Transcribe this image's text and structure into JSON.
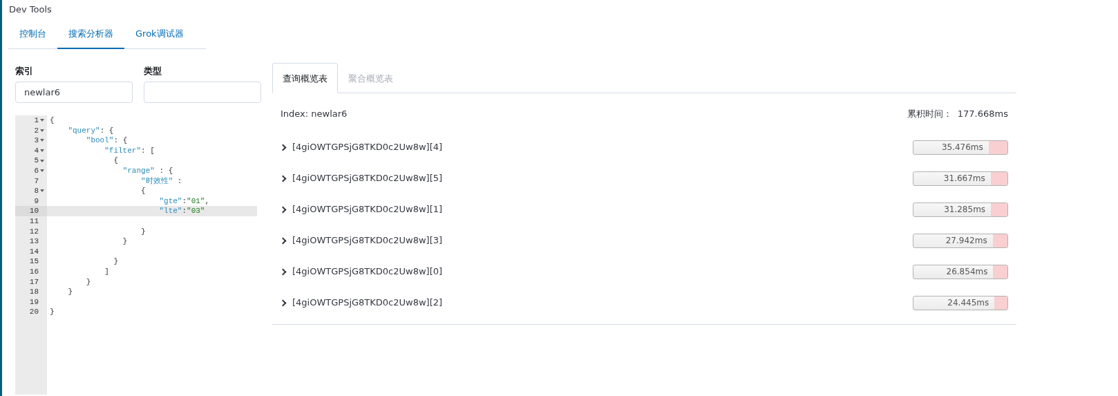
{
  "window": {
    "title": "Dev Tools"
  },
  "tabs": [
    {
      "label": "控制台",
      "selected": false
    },
    {
      "label": "搜索分析器",
      "selected": true
    },
    {
      "label": "Grok调试器",
      "selected": false
    }
  ],
  "fields": [
    {
      "label": "索引",
      "value": "newlar6"
    },
    {
      "label": "类型"
    }
  ],
  "editor": {
    "lines": [
      {
        "number": "1",
        "text": "{",
        "foldable": true,
        "active": false
      },
      {
        "number": "2",
        "text": "    \"query\": {",
        "foldable": true,
        "active": false
      },
      {
        "number": "3",
        "text": "        \"bool\": {",
        "foldable": true,
        "active": false
      },
      {
        "number": "4",
        "text": "            \"filter\": [",
        "foldable": true,
        "active": false
      },
      {
        "number": "5",
        "text": "              {",
        "foldable": true,
        "active": false
      },
      {
        "number": "6",
        "text": "                \"range\" : {",
        "foldable": true,
        "active": false
      },
      {
        "number": "7",
        "text": "                    \"时效性\" :",
        "foldable": false,
        "active": false
      },
      {
        "number": "8",
        "text": "                    {",
        "foldable": true,
        "active": false
      },
      {
        "number": "9",
        "text": "                        \"gte\":\"01\",",
        "foldable": false,
        "active": false
      },
      {
        "number": "10",
        "text": "                        \"lte\":\"03\"",
        "foldable": false,
        "active": true
      },
      {
        "number": "11",
        "foldable": false,
        "active": false
      },
      {
        "number": "12",
        "text": "                    }",
        "foldable": false,
        "active": false
      },
      {
        "number": "13",
        "text": "                }",
        "foldable": false,
        "active": false
      },
      {
        "number": "14",
        "foldable": false,
        "active": false
      },
      {
        "number": "15",
        "text": "              }",
        "foldable": false,
        "active": false
      },
      {
        "number": "16",
        "text": "            ]",
        "foldable": false,
        "active": false
      },
      {
        "number": "17",
        "text": "        }",
        "foldable": false,
        "active": false
      },
      {
        "number": "18",
        "text": "    }",
        "foldable": false,
        "active": false
      },
      {
        "number": "19",
        "foldable": false,
        "active": false
      },
      {
        "number": "20",
        "text": "}",
        "foldable": false,
        "active": false
      }
    ]
  },
  "profile": {
    "tabs": [
      {
        "label": "查询概览表",
        "selected": true
      },
      {
        "label": "聚合概览表",
        "selected": false
      }
    ],
    "index": "Index: newlar6",
    "total_label": "累积时间：",
    "total": "177.668ms",
    "shards": [
      {
        "name": "[4giOWTGPSjG8TKD0c2Uw8w][4]",
        "reading": "35.476ms",
        "level": 0.2
      },
      {
        "name": "[4giOWTGPSjG8TKD0c2Uw8w][5]",
        "reading": "31.667ms",
        "level": 0.178
      },
      {
        "name": "[4giOWTGPSjG8TKD0c2Uw8w][1]",
        "reading": "31.285ms",
        "level": 0.176
      },
      {
        "name": "[4giOWTGPSjG8TKD0c2Uw8w][3]",
        "reading": "27.942ms",
        "level": 0.157
      },
      {
        "name": "[4giOWTGPSjG8TKD0c2Uw8w][0]",
        "reading": "26.854ms",
        "level": 0.151
      },
      {
        "name": "[4giOWTGPSjG8TKD0c2Uw8w][2]",
        "reading": "24.445ms",
        "level": 0.138
      }
    ]
  }
}
